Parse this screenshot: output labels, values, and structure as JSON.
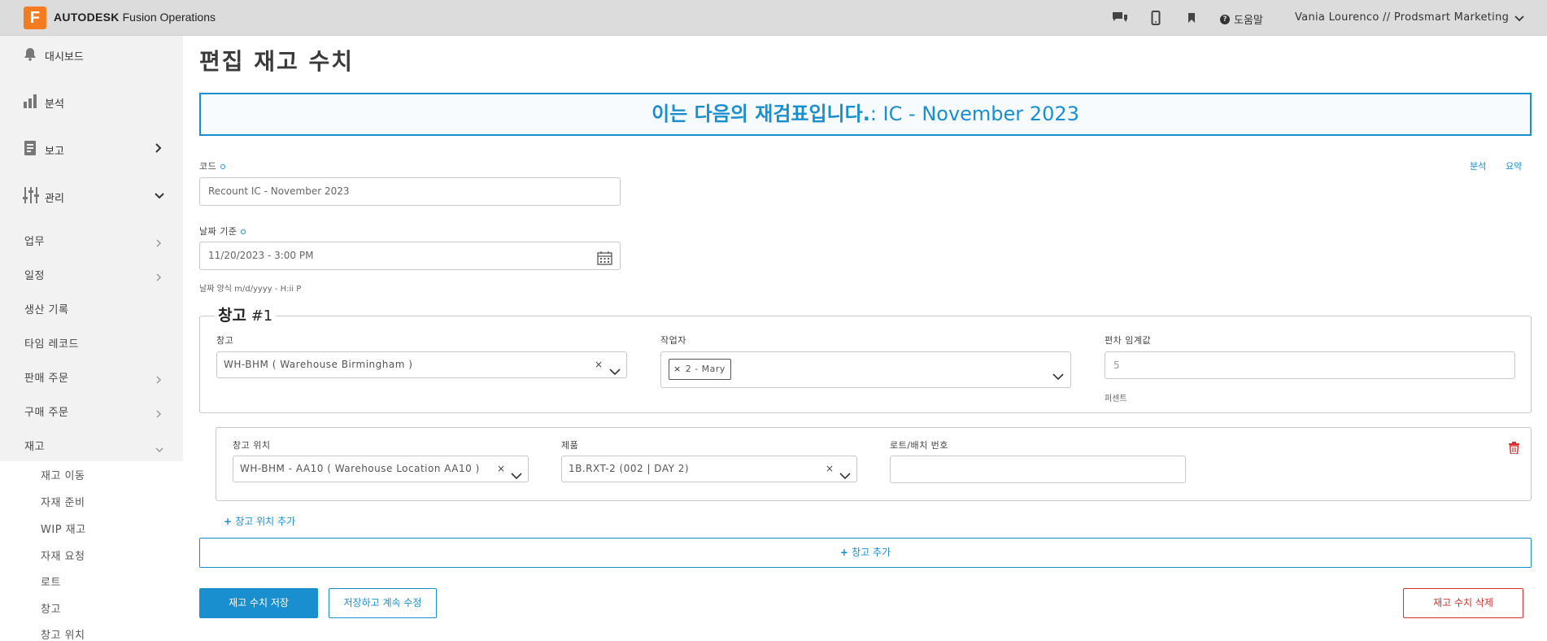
{
  "topbar": {
    "logo_letter": "F",
    "brand_bold": "AUTODESK",
    "brand_rest": " Fusion Operations",
    "help_label": "도움말",
    "user_label": "Vania Lourenco // Prodsmart Marketing"
  },
  "sidebar": {
    "dashboard": "대시보드",
    "analysis": "분석",
    "reports": "보고",
    "management": "관리",
    "sub": {
      "tasks": "업무",
      "schedule": "일정",
      "production_log": "생산 기록",
      "time_records": "타임 레코드",
      "sales_orders": "판매 주문",
      "purchase_orders": "구매 주문",
      "inventory": "재고"
    },
    "inventory_items": [
      "재고 이동",
      "자재 준비",
      "WIP 재고",
      "자재 요청",
      "로트",
      "창고",
      "창고 위치"
    ]
  },
  "page": {
    "title": "편집 재고 수치",
    "banner_prefix": "이는 다음의 재검표입니다.",
    "banner_suffix": ": IC - November 2023",
    "code_label": "코드",
    "code_value": "Recount IC - November 2023",
    "link_analysis": "분석",
    "link_summary": "요약",
    "date_label": "날짜 기준",
    "date_value": "11/20/2023 - 3:00 PM",
    "date_hint": "날짜 양식 m/d/yyyy - H:ii P"
  },
  "warehouse": {
    "legend_text": "창고",
    "legend_num": " #1",
    "warehouse_label": "창고",
    "warehouse_value": "WH-BHM ( Warehouse Birmingham )",
    "worker_label": "작업자",
    "worker_tag": "2 - Mary",
    "threshold_label": "편차 임계값",
    "threshold_placeholder": "5",
    "threshold_hint": "퍼센트"
  },
  "location": {
    "location_label": "창고 위치",
    "location_value": "WH-BHM - AA10 ( Warehouse Location AA10 )",
    "product_label": "제품",
    "product_value": "1B.RXT-2 (002 | DAY 2)",
    "lot_label": "로트/배치 번호",
    "lot_value": ""
  },
  "actions": {
    "add_location": "창고 위치 추가",
    "add_warehouse": "창고 추가",
    "save": "재고 수치 저장",
    "save_continue": "저장하고 계속 수정",
    "delete": "재고 수치 삭제"
  },
  "colors": {
    "accent": "#1a8fd0",
    "danger": "#d62f2f",
    "brand_orange": "#f47b20"
  }
}
